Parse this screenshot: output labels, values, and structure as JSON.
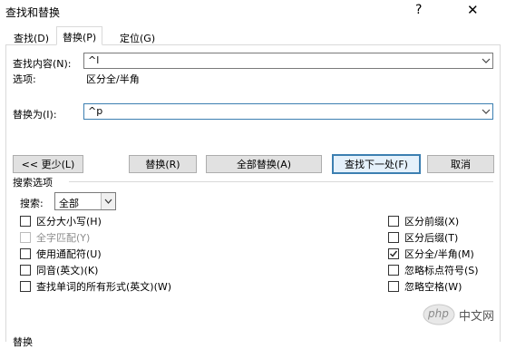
{
  "window": {
    "title": "查找和替换",
    "help_label": "?",
    "close_label": "✕"
  },
  "tabs": [
    {
      "label": "查找(D)"
    },
    {
      "label": "替换(P)"
    },
    {
      "label": "定位(G)"
    }
  ],
  "find": {
    "label": "查找内容(N):",
    "value": "^l",
    "options_label": "选项:",
    "options_value": "区分全/半角"
  },
  "replace": {
    "label": "替换为(I):",
    "value": "^p"
  },
  "buttons": {
    "less": "<< 更少(L)",
    "replace": "替换(R)",
    "replace_all": "全部替换(A)",
    "find_next": "查找下一处(F)",
    "cancel": "取消"
  },
  "search_options": {
    "section_title": "搜索选项",
    "search_label": "搜索:",
    "search_value": "全部",
    "left_checks": [
      {
        "label": "区分大小写(H)",
        "checked": false,
        "disabled": false
      },
      {
        "label": "全字匹配(Y)",
        "checked": false,
        "disabled": true
      },
      {
        "label": "使用通配符(U)",
        "checked": false,
        "disabled": false
      },
      {
        "label": "同音(英文)(K)",
        "checked": false,
        "disabled": false
      },
      {
        "label": "查找单词的所有形式(英文)(W)",
        "checked": false,
        "disabled": false
      }
    ],
    "right_checks": [
      {
        "label": "区分前缀(X)",
        "checked": false,
        "disabled": false
      },
      {
        "label": "区分后缀(T)",
        "checked": false,
        "disabled": false
      },
      {
        "label": "区分全/半角(M)",
        "checked": true,
        "disabled": false
      },
      {
        "label": "忽略标点符号(S)",
        "checked": false,
        "disabled": false
      },
      {
        "label": "忽略空格(W)",
        "checked": false,
        "disabled": false
      }
    ]
  },
  "footer": {
    "label": "替换"
  },
  "watermark": {
    "brand": "php",
    "text": "中文网"
  }
}
